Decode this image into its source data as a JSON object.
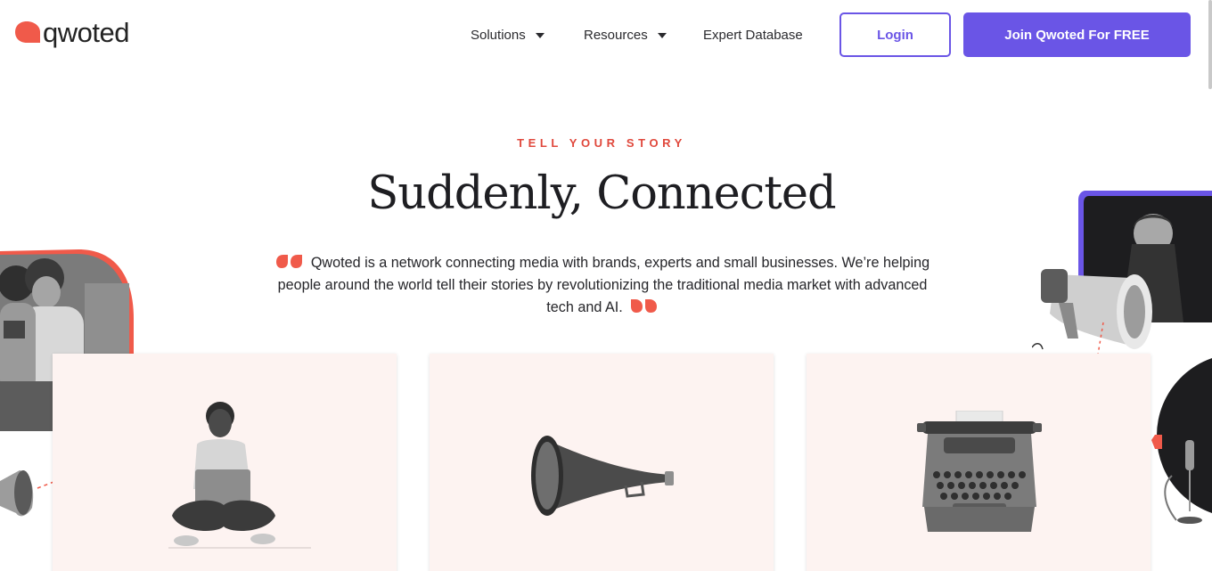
{
  "header": {
    "logo_text": "qwoted",
    "nav": {
      "solutions": "Solutions",
      "resources": "Resources",
      "expert_database": "Expert Database"
    },
    "login_label": "Login",
    "join_label": "Join Qwoted For FREE"
  },
  "hero": {
    "eyebrow": "TELL YOUR STORY",
    "headline": "Suddenly, Connected",
    "intro": "Qwoted is a network connecting media with brands, experts and small businesses. We’re helping people around the world tell their stories by revolutionizing the traditional media market with advanced tech and AI."
  },
  "colors": {
    "brand_red": "#f05a4a",
    "accent_purple": "#6a55e6",
    "card_bg": "#fdf3f1"
  },
  "icons": [
    "qwoted-logo-icon",
    "caret-down-icon",
    "quote-open-icon",
    "quote-close-icon"
  ]
}
